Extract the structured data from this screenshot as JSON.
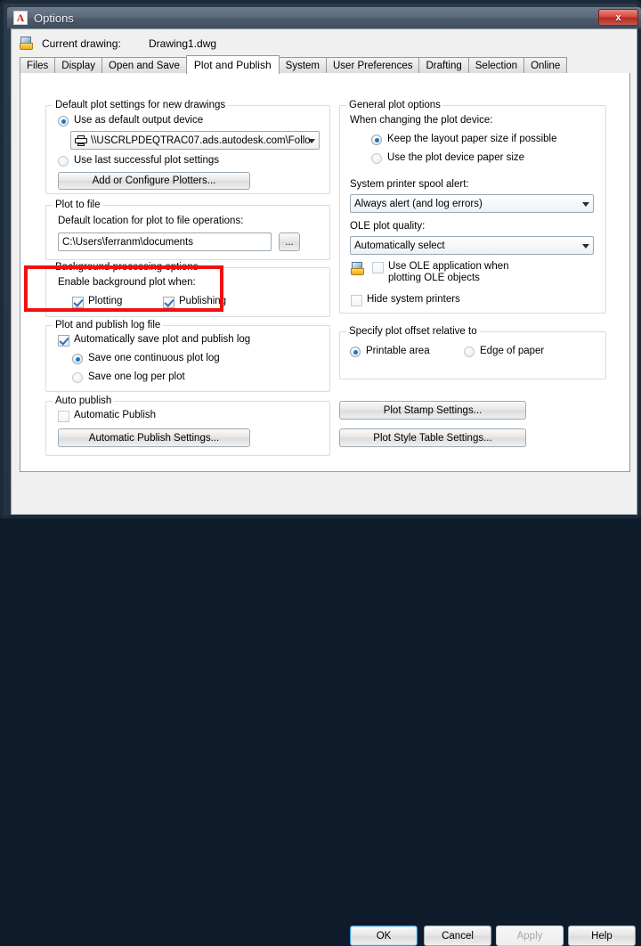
{
  "window": {
    "title": "Options",
    "logo_icon": "autocad-a-icon",
    "close_label": "x"
  },
  "header": {
    "current_drawing_label": "Current drawing:",
    "current_drawing_value": "Drawing1.dwg",
    "drawing_icon": "drawing-file-icon"
  },
  "tabs": [
    {
      "label": "Files",
      "active": false
    },
    {
      "label": "Display",
      "active": false
    },
    {
      "label": "Open and Save",
      "active": false
    },
    {
      "label": "Plot and Publish",
      "active": true
    },
    {
      "label": "System",
      "active": false
    },
    {
      "label": "User Preferences",
      "active": false
    },
    {
      "label": "Drafting",
      "active": false
    },
    {
      "label": "Selection",
      "active": false
    },
    {
      "label": "Online",
      "active": false
    }
  ],
  "left": {
    "default_plot": {
      "legend": "Default plot settings for new drawings",
      "radio_default_device": "Use as default output device",
      "device_value": "\\\\USCRLPDEQTRAC07.ads.autodesk.com\\Follo",
      "device_icon": "printer-icon",
      "radio_last_settings": "Use last successful plot settings",
      "add_plotters_button": "Add or Configure Plotters..."
    },
    "plot_to_file": {
      "legend": "Plot to file",
      "label": "Default location for plot to file operations:",
      "path_value": "C:\\Users\\ferranm\\documents",
      "browse_button": "..."
    },
    "background": {
      "legend": "Background processing options",
      "label": "Enable background plot when:",
      "check_plotting": "Plotting",
      "check_publishing": "Publishing",
      "highlight_color": "#ee1111"
    },
    "log_file": {
      "legend": "Plot and publish log file",
      "check_autosave": "Automatically save plot and publish log",
      "radio_continuous": "Save one continuous plot log",
      "radio_per_plot": "Save one log per plot"
    },
    "auto_publish": {
      "legend": "Auto publish",
      "check_automatic": "Automatic Publish",
      "settings_button": "Automatic Publish Settings..."
    }
  },
  "right": {
    "general": {
      "legend": "General plot options",
      "label_changing": "When changing the plot device:",
      "radio_keep_layout": "Keep the layout paper size if possible",
      "radio_device_size": "Use the plot device paper size",
      "label_spool": "System printer spool alert:",
      "spool_value": "Always alert (and log errors)",
      "label_ole": "OLE plot quality:",
      "ole_value": "Automatically select",
      "check_use_ole": "Use OLE application when plotting OLE objects",
      "ole_icon": "drawing-file-icon",
      "check_hide_printers": "Hide system printers"
    },
    "offset": {
      "legend": "Specify plot offset relative to",
      "radio_printable": "Printable area",
      "radio_edge": "Edge of paper"
    },
    "buttons": {
      "plot_stamp": "Plot Stamp Settings...",
      "plot_style": "Plot Style Table Settings..."
    }
  },
  "footer": {
    "ok": "OK",
    "cancel": "Cancel",
    "apply": "Apply",
    "help": "Help"
  }
}
